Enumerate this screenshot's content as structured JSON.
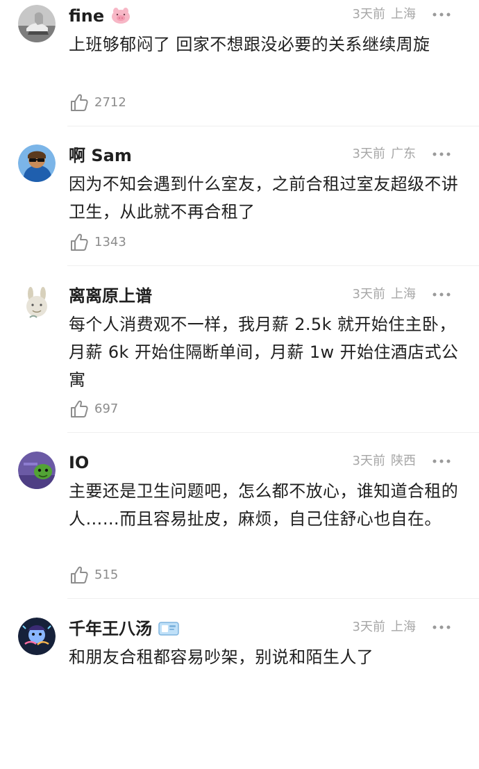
{
  "comments": [
    {
      "username": "fine",
      "time": "3天前",
      "location": "上海",
      "text": "上班够郁闷了 回家不想跟没必要的关系继续周旋",
      "likes": "2712"
    },
    {
      "username": "啊 Sam",
      "time": "3天前",
      "location": "广东",
      "text": "因为不知会遇到什么室友，之前合租过室友超级不讲卫生，从此就不再合租了",
      "likes": "1343"
    },
    {
      "username": "离离原上谱",
      "time": "3天前",
      "location": "上海",
      "text": "每个人消费观不一样，我月薪 2.5k 就开始住主卧，月薪 6k 开始住隔断单间，月薪 1w 开始住酒店式公寓",
      "likes": "697"
    },
    {
      "username": "IO",
      "time": "3天前",
      "location": "陕西",
      "text": "主要还是卫生问题吧，怎么都不放心，谁知道合租的人……而且容易扯皮，麻烦，自己住舒心也自在。",
      "likes": "515"
    },
    {
      "username": "千年王八汤",
      "time": "3天前",
      "location": "上海",
      "text": "和朋友合租都容易吵架，别说和陌生人了",
      "likes": ""
    }
  ],
  "icons": {
    "more": "more-icon",
    "like": "thumbs-up-icon",
    "pig_badge": "pig-badge-icon",
    "card_badge": "card-badge-icon"
  },
  "colors": {
    "meta": "#a6a6a6",
    "like_count": "#8c8c8c",
    "text": "#1f1f1f",
    "divider": "#efefef"
  }
}
